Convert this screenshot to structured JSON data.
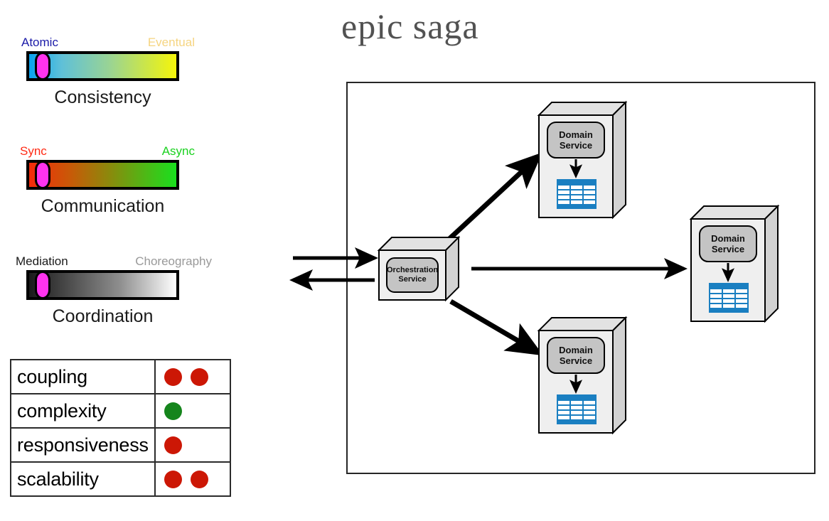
{
  "title": "epic saga",
  "sliders": [
    {
      "id": "consistency",
      "label": "Consistency",
      "left_cap": "Atomic",
      "right_cap": "Eventual",
      "left_cap_color": "#1a1aa8",
      "right_cap_color": "#f5d480",
      "gradient_from": "#0aa3f0",
      "gradient_to": "#f5f50a",
      "thumb_color": "#ff33ee",
      "thumb_position_pct": 8
    },
    {
      "id": "communication",
      "label": "Communication",
      "left_cap": "Sync",
      "right_cap": "Async",
      "left_cap_color": "#ff2a14",
      "right_cap_color": "#19d11e",
      "gradient_from": "#f52a0a",
      "gradient_to": "#19e01e",
      "thumb_color": "#ff33ee",
      "thumb_position_pct": 8
    },
    {
      "id": "coordination",
      "label": "Coordination",
      "left_cap": "Mediation",
      "right_cap": "Choreography",
      "left_cap_color": "#1a1a1a",
      "right_cap_color": "#999999",
      "gradient_from": "#1a1a1a",
      "gradient_to": "#ffffff",
      "thumb_color": "#ff33ee",
      "thumb_position_pct": 8
    }
  ],
  "ratings": {
    "red_color": "#cc1705",
    "green_color": "#15851c",
    "rows": [
      {
        "name": "coupling",
        "red": 2,
        "green": 0
      },
      {
        "name": "complexity",
        "red": 0,
        "green": 1
      },
      {
        "name": "responsiveness",
        "red": 1,
        "green": 0
      },
      {
        "name": "scalability",
        "red": 2,
        "green": 0
      }
    ]
  },
  "diagram": {
    "orchestrator": {
      "line1": "Orchestration",
      "line2": "Service"
    },
    "services": [
      {
        "id": "top",
        "line1": "Domain",
        "line2": "Service"
      },
      {
        "id": "right",
        "line1": "Domain",
        "line2": "Service"
      },
      {
        "id": "bottom",
        "line1": "Domain",
        "line2": "Service"
      }
    ],
    "database_color": "#1a7fc1",
    "node_face_color": "#efefef",
    "node_badge_color": "#c4c4c4"
  }
}
